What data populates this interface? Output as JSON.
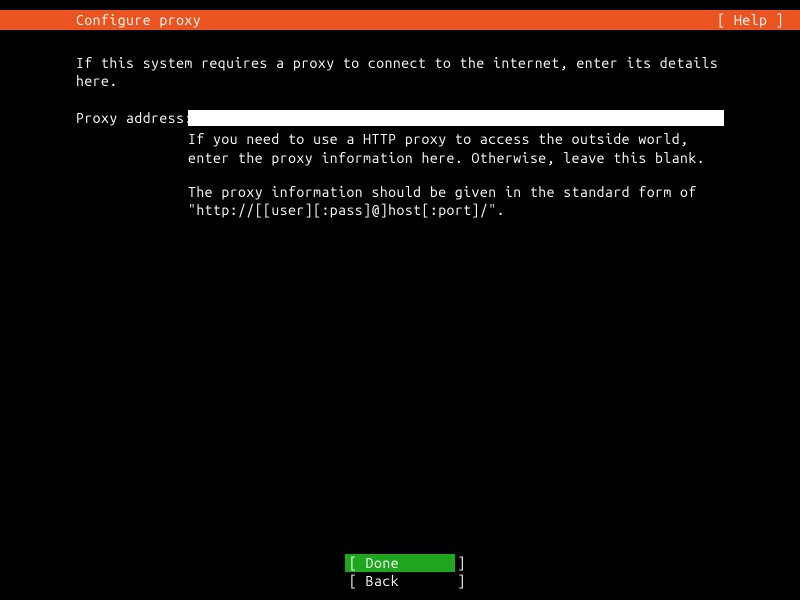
{
  "header": {
    "title": "Configure proxy",
    "help": "[ Help ]"
  },
  "instruction": "If this system requires a proxy to connect to the internet, enter its details here.",
  "form": {
    "label": "Proxy address:",
    "value": "",
    "hint1": "If you need to use a HTTP proxy to access the outside world, enter the proxy information here. Otherwise, leave this blank.",
    "hint2": "The proxy information should be given in the standard form of \"http://[[user][:pass]@]host[:port]/\"."
  },
  "footer": {
    "done": "[ Done       ]",
    "back": "[ Back       ]"
  }
}
